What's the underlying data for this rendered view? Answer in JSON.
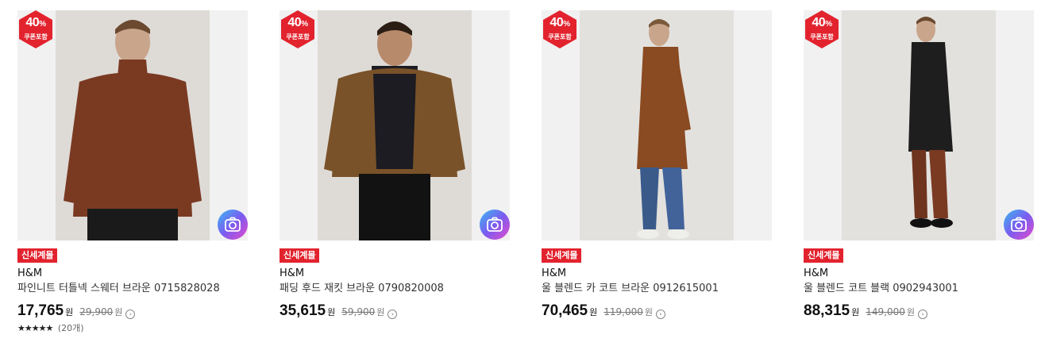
{
  "colors": {
    "badge_red": "#e2232e",
    "price_text": "#111111",
    "strike_text": "#777777"
  },
  "icons": {
    "camera_lens": "camera-search-icon",
    "info": "info-circle-icon",
    "star": "star-icon"
  },
  "products": [
    {
      "badge_percent": "40",
      "badge_unit": "%",
      "badge_sub": "쿠폰포함",
      "tag": "신세계몰",
      "brand": "H&M",
      "title": "파인니트 터틀넥 스웨터 브라운 0715828028",
      "price": "17,765",
      "currency": "원",
      "original_price": "29,900",
      "stars": "★★★★★",
      "review_count": "(20개)",
      "item_color": "#7a3a22"
    },
    {
      "badge_percent": "40",
      "badge_unit": "%",
      "badge_sub": "쿠폰포함",
      "tag": "신세계몰",
      "brand": "H&M",
      "title": "패딩 후드 재킷 브라운 0790820008",
      "price": "35,615",
      "currency": "원",
      "original_price": "59,900",
      "item_color": "#7a5229"
    },
    {
      "badge_percent": "40",
      "badge_unit": "%",
      "badge_sub": "쿠폰포함",
      "tag": "신세계몰",
      "brand": "H&M",
      "title": "울 블렌드 카 코트 브라운 0912615001",
      "price": "70,465",
      "currency": "원",
      "original_price": "119,000",
      "item_color": "#8a4a22"
    },
    {
      "badge_percent": "40",
      "badge_unit": "%",
      "badge_sub": "쿠폰포함",
      "tag": "신세계몰",
      "brand": "H&M",
      "title": "울 블렌드 코트 블랙 0902943001",
      "price": "88,315",
      "currency": "원",
      "original_price": "149,000",
      "item_color": "#1e1e1e"
    }
  ]
}
